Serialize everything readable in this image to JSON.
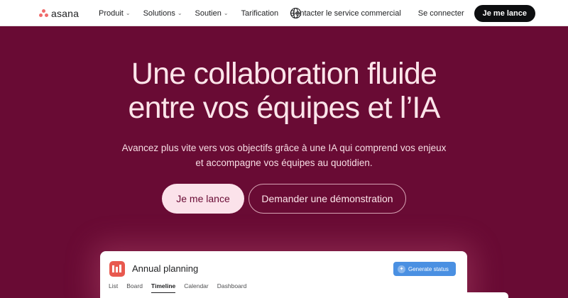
{
  "brand": {
    "name": "asana",
    "logo_color": "#f06a6a"
  },
  "nav": {
    "items": [
      {
        "label": "Produit",
        "has_dropdown": true
      },
      {
        "label": "Solutions",
        "has_dropdown": true
      },
      {
        "label": "Soutien",
        "has_dropdown": true
      },
      {
        "label": "Tarification",
        "has_dropdown": false
      }
    ],
    "language_icon": "globe-icon",
    "contact_sales": "Contacter le service commercial",
    "sign_in": "Se connecter",
    "cta": "Je me lance"
  },
  "hero": {
    "title_line1": "Une collaboration fluide",
    "title_line2": "entre vos équipes et l’IA",
    "subtitle_line1": "Avancez plus vite vers vos objectifs grâce à une IA qui comprend vos enjeux",
    "subtitle_line2": "et accompagne vos équipes au quotidien.",
    "primary_button": "Je me lance",
    "secondary_button": "Demander une démonstration",
    "background_color": "#690b34"
  },
  "preview": {
    "project_title": "Annual planning",
    "generate_button": "Generate status",
    "tabs": [
      {
        "label": "List",
        "active": false
      },
      {
        "label": "Board",
        "active": false
      },
      {
        "label": "Timeline",
        "active": true
      },
      {
        "label": "Calendar",
        "active": false
      },
      {
        "label": "Dashboard",
        "active": false
      }
    ]
  }
}
